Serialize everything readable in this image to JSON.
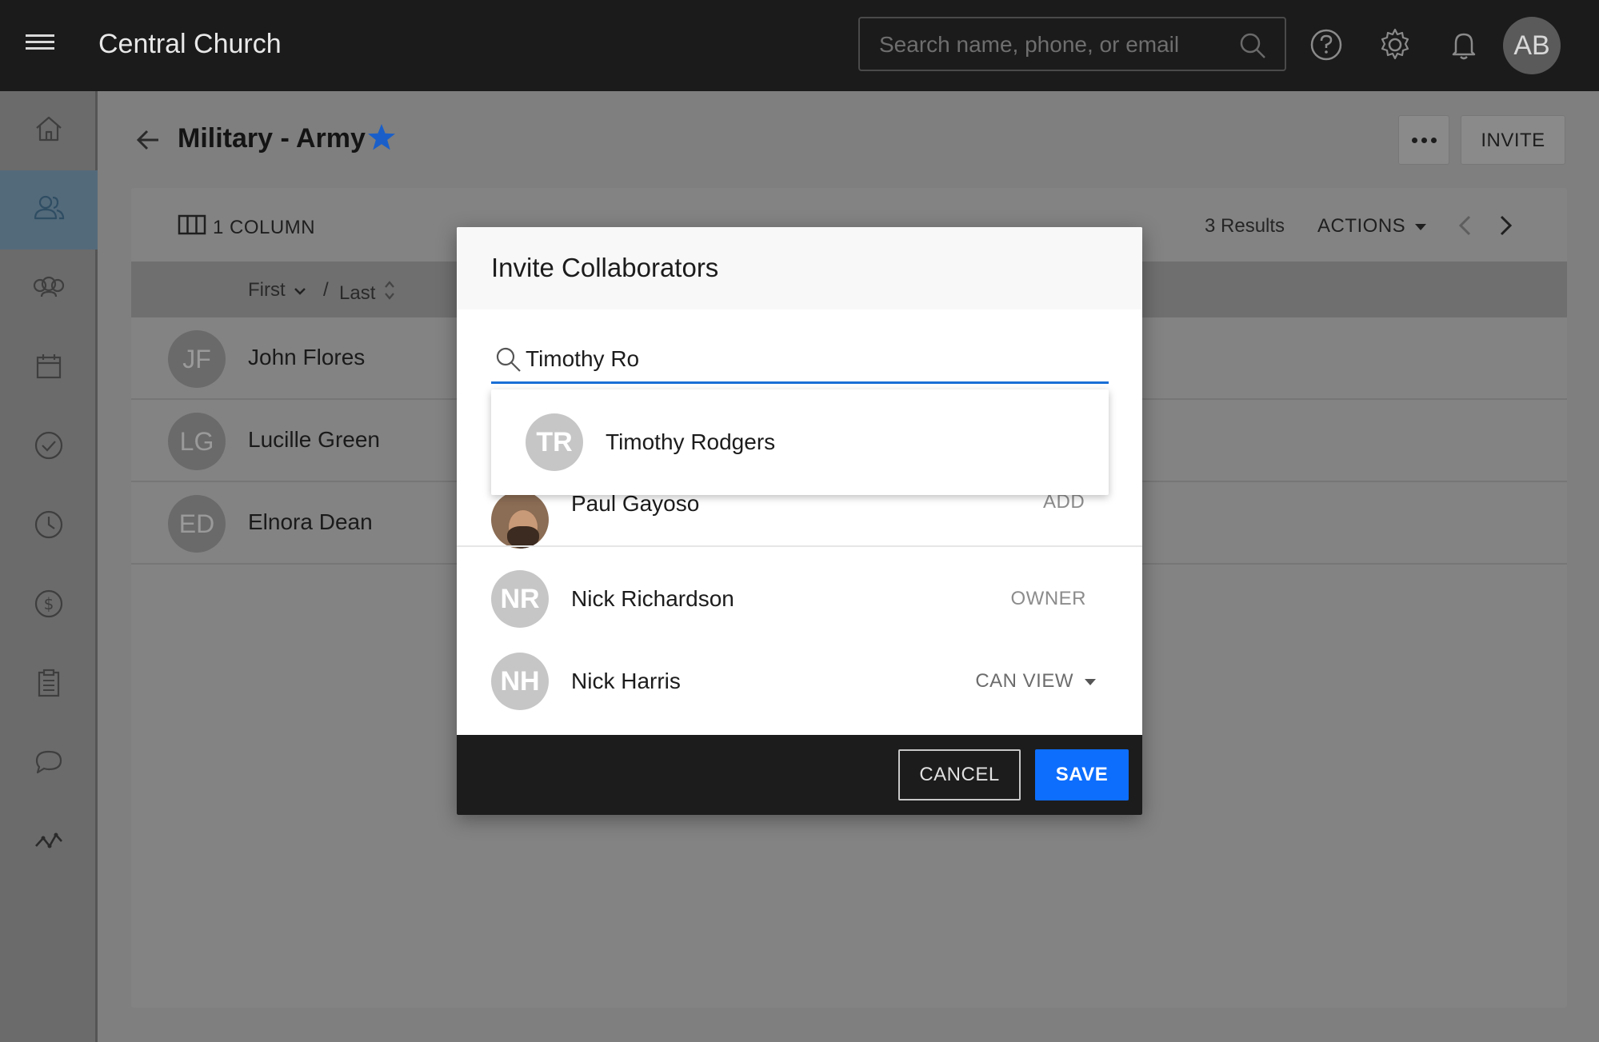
{
  "topbar": {
    "title": "Central Church",
    "search_placeholder": "Search name, phone, or email",
    "user_initials": "AB"
  },
  "sidebar": {
    "items": [
      {
        "icon": "home-icon"
      },
      {
        "icon": "people-icon",
        "active": true
      },
      {
        "icon": "groups-icon"
      },
      {
        "icon": "calendar-icon"
      },
      {
        "icon": "check-circle-icon"
      },
      {
        "icon": "clock-icon"
      },
      {
        "icon": "dollar-icon"
      },
      {
        "icon": "clipboard-icon"
      },
      {
        "icon": "chat-icon"
      },
      {
        "icon": "analytics-icon"
      }
    ]
  },
  "page": {
    "title": "Military - Army",
    "invite_label": "INVITE"
  },
  "table": {
    "columns_label": "1 COLUMN",
    "results": "3 Results",
    "actions_label": "ACTIONS",
    "sort_first": "First",
    "sort_separator": "/",
    "sort_last": "Last",
    "rows": [
      {
        "initials": "JF",
        "name": "John Flores"
      },
      {
        "initials": "LG",
        "name": "Lucille Green"
      },
      {
        "initials": "ED",
        "name": "Elnora Dean"
      }
    ]
  },
  "modal": {
    "title": "Invite Collaborators",
    "search_value": "Timothy Ro",
    "suggestion": {
      "initials": "TR",
      "name": "Timothy Rodgers"
    },
    "pending": {
      "name": "Paul Gayoso",
      "action": "ADD"
    },
    "collaborators": [
      {
        "initials": "NR",
        "name": "Nick Richardson",
        "role": "OWNER"
      },
      {
        "initials": "NH",
        "name": "Nick Harris",
        "permission": "CAN VIEW"
      }
    ],
    "cancel_label": "CANCEL",
    "save_label": "SAVE"
  },
  "colors": {
    "accent": "#0d6efd",
    "star": "#1a5fc9",
    "topbar": "#1b1b1b"
  }
}
